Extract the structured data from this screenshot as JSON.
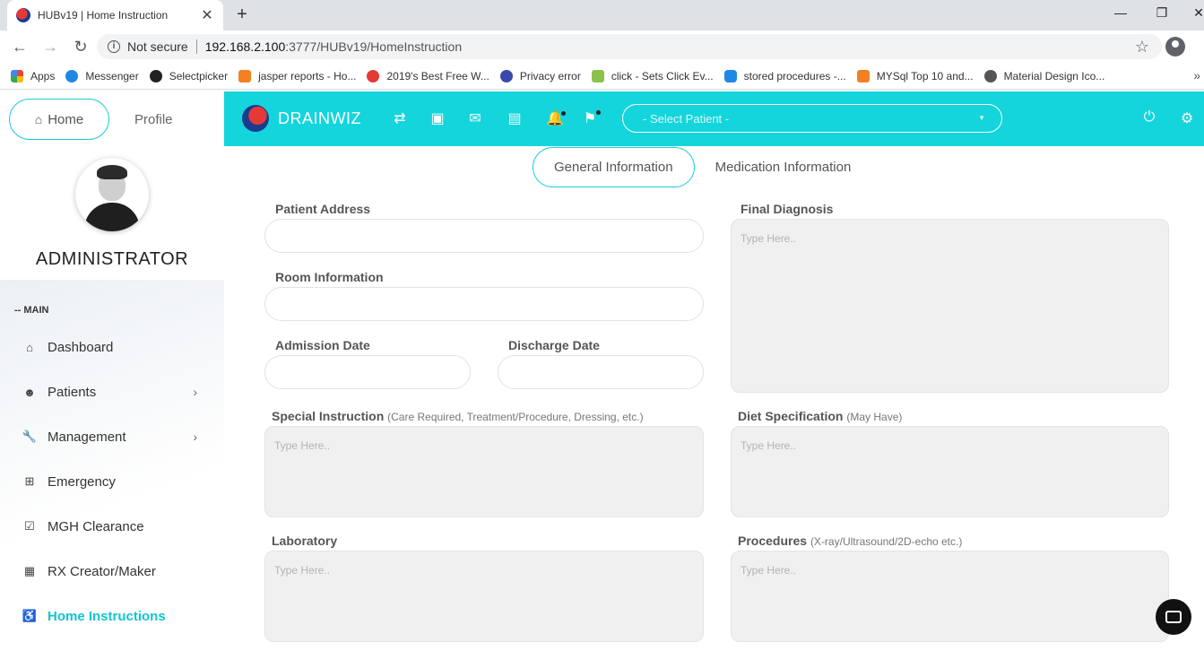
{
  "browser": {
    "tab_title": "HUBv19 | Home Instruction",
    "tab_close": "✕",
    "new_tab": "+",
    "window_controls": [
      "—",
      "❐",
      "✕"
    ],
    "nav": {
      "back": "←",
      "forward": "→",
      "reload": "↻"
    },
    "security_text": "Not secure",
    "url_host": "192.168.2.100",
    "url_rest": ":3777/HUBv19/HomeInstruction",
    "star": "☆",
    "bookmarks": [
      {
        "label": "Apps",
        "icon": "apps-grid-icon",
        "color": "#e8453c"
      },
      {
        "label": "Messenger",
        "icon": "messenger-icon",
        "color": "#1e88e5"
      },
      {
        "label": "Selectpicker",
        "icon": "github-icon",
        "color": "#222222"
      },
      {
        "label": "jasper reports - Ho...",
        "icon": "stackoverflow-icon",
        "color": "#f48024"
      },
      {
        "label": "2019's Best Free W...",
        "icon": "swirl-icon",
        "color": "#e53935"
      },
      {
        "label": "Privacy error",
        "icon": "globe-icon",
        "color": "#3949ab"
      },
      {
        "label": "click - Sets Click Ev...",
        "icon": "pinwheel-icon",
        "color": "#8bc34a"
      },
      {
        "label": "stored procedures -...",
        "icon": "database-icon",
        "color": "#1e88e5"
      },
      {
        "label": "MYSql Top 10 and...",
        "icon": "stackoverflow-icon",
        "color": "#f48024"
      },
      {
        "label": "Material Design Ico...",
        "icon": "globe-icon",
        "color": "#555555"
      }
    ],
    "bookmarks_more": "»"
  },
  "sidebar": {
    "home_tab": "Home",
    "profile_tab": "Profile",
    "user_name": "ADMINISTRATOR",
    "section_label": "-- MAIN",
    "items": [
      {
        "label": "Dashboard",
        "icon": "home-icon",
        "glyph": "⌂",
        "has_submenu": false
      },
      {
        "label": "Patients",
        "icon": "face-icon",
        "glyph": "☻",
        "has_submenu": true
      },
      {
        "label": "Management",
        "icon": "wrench-icon",
        "glyph": "🔧",
        "has_submenu": true
      },
      {
        "label": "Emergency",
        "icon": "plus-box-icon",
        "glyph": "⊞",
        "has_submenu": false
      },
      {
        "label": "MGH Clearance",
        "icon": "check-box-icon",
        "glyph": "☑",
        "has_submenu": false
      },
      {
        "label": "RX Creator/Maker",
        "icon": "dashboard-grid-icon",
        "glyph": "▦",
        "has_submenu": false
      },
      {
        "label": "Home Instructions",
        "icon": "wheelchair-icon",
        "glyph": "♿",
        "has_submenu": false,
        "active": true
      }
    ],
    "chevron": "›"
  },
  "topbar": {
    "brand": "DRAINWIZ",
    "patient_select_placeholder": "- Select Patient -",
    "accent_color": "#14d5dc"
  },
  "form": {
    "tabs": [
      "General Information",
      "Medication Information"
    ],
    "active_tab": "General Information",
    "patient_address_label": "Patient Address",
    "room_information_label": "Room Information",
    "admission_date_label": "Admission Date",
    "discharge_date_label": "Discharge Date",
    "final_diagnosis_label": "Final Diagnosis",
    "special_instruction_label": "Special Instruction",
    "special_instruction_note": "(Care Required, Treatment/Procedure, Dressing, etc.)",
    "diet_specification_label": "Diet Specification",
    "diet_specification_note": "(May Have)",
    "laboratory_label": "Laboratory",
    "procedures_label": "Procedures",
    "procedures_note": "(X-ray/Ultrasound/2D-echo etc.)",
    "textarea_placeholder": "Type Here.."
  }
}
